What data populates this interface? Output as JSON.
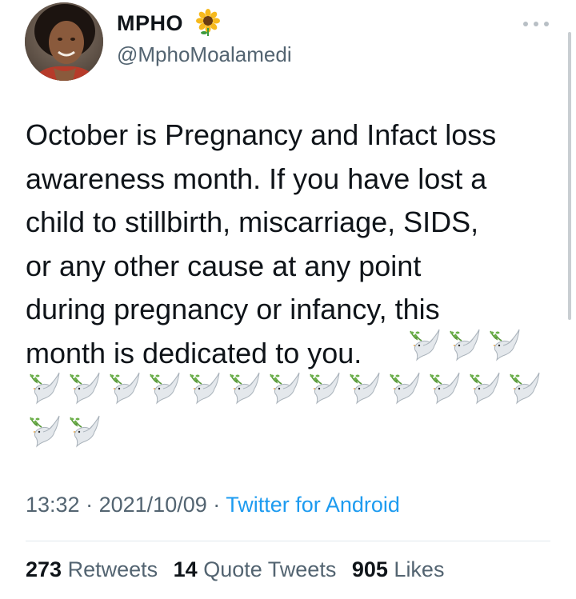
{
  "author": {
    "name": "MPHO",
    "name_emoji": "sunflower",
    "handle": "@MphoMoalamedi"
  },
  "tweet": {
    "text_lines": [
      "October is Pregnancy and Infact loss",
      "awareness month. If you have lost a",
      "child to stillbirth, miscarriage, SIDS,",
      "or any other cause at any point",
      "during pregnancy or infancy, this",
      "month is dedicated to you."
    ],
    "emoji": "dove",
    "emoji_count_inline": 3,
    "emoji_count_row2": 13,
    "emoji_count_row3": 2
  },
  "meta": {
    "time": "13:32",
    "separator": "·",
    "date": "2021/10/09",
    "source": "Twitter for Android"
  },
  "stats": {
    "retweets_count": "273",
    "retweets_label": "Retweets",
    "quote_count": "14",
    "quote_label": "Quote Tweets",
    "likes_count": "905",
    "likes_label": "Likes"
  },
  "colors": {
    "text_primary": "#0f1419",
    "text_secondary": "#536471",
    "link": "#1d9bf0",
    "divider": "#e1e8ed"
  },
  "icons": {
    "more": "more-options-icon",
    "avatar": "profile-avatar",
    "name_emoji": "sunflower-icon",
    "dove": "dove-icon"
  }
}
